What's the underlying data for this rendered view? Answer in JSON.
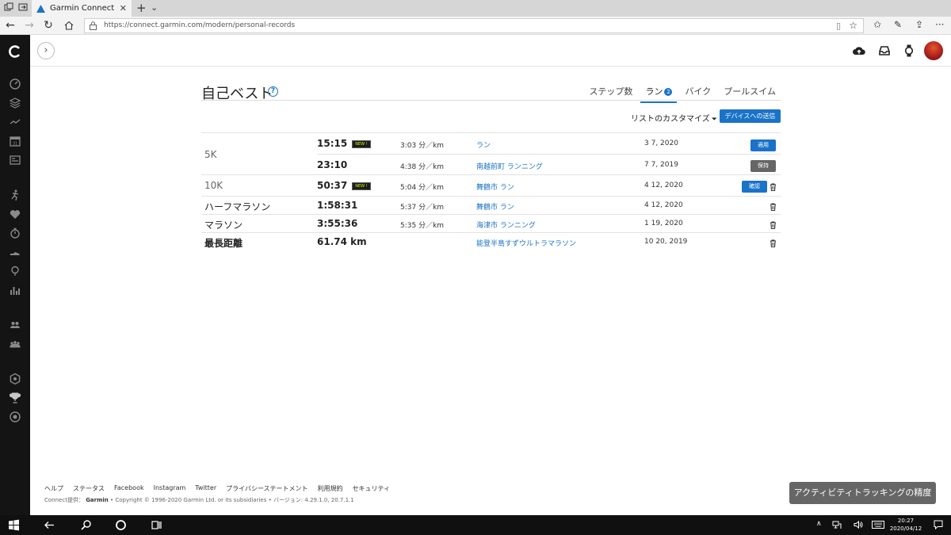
{
  "browser": {
    "tab_title": "Garmin Connect",
    "url": "https://connect.garmin.com/modern/personal-records"
  },
  "page": {
    "title": "自己ベスト",
    "help_glyph": "?",
    "tabs": [
      {
        "label": "ステップ数"
      },
      {
        "label": "ラン",
        "badge": "2"
      },
      {
        "label": "バイク"
      },
      {
        "label": "プールスイム"
      }
    ],
    "customize_label": "リストのカスタマイズ",
    "send_button": "デバイスへの送信"
  },
  "records": [
    {
      "category": "5K",
      "time": "15:15",
      "new_badge": "NEW !",
      "pace": "3:03 分／km",
      "activity": "ラン",
      "date": "3 7, 2020",
      "action": "適用"
    },
    {
      "category": "",
      "time": "23:10",
      "new_badge": "",
      "pace": "4:38 分／km",
      "activity": "南越前町 ランニング",
      "date": "7 7, 2019",
      "action": "保持"
    },
    {
      "category": "10K",
      "time": "50:37",
      "new_badge": "NEW !",
      "pace": "5:04 分／km",
      "activity": "舞鶴市 ラン",
      "date": "4 12, 2020",
      "action": "確認"
    },
    {
      "category": "ハーフマラソン",
      "time": "1:58:31",
      "new_badge": "",
      "pace": "5:37 分／km",
      "activity": "舞鶴市 ラン",
      "date": "4 12, 2020",
      "action": ""
    },
    {
      "category": "マラソン",
      "time": "3:55:36",
      "new_badge": "",
      "pace": "5:35 分／km",
      "activity": "海津市 ランニング",
      "date": "1 19, 2020",
      "action": ""
    },
    {
      "category": "最長距離",
      "time": "61.74 km",
      "new_badge": "",
      "pace": "",
      "activity": "能登半島すずウルトラマラソン",
      "date": "10 20, 2019",
      "action": ""
    }
  ],
  "footer": {
    "links": [
      "ヘルプ",
      "ステータス",
      "Facebook",
      "Instagram",
      "Twitter",
      "プライバシーステートメント",
      "利用規約",
      "セキュリティ"
    ],
    "copyright_prefix": "Connect提供：",
    "copyright_brand": "Garmin",
    "copyright_rest": "• Copyright © 1996-2020 Garmin Ltd. or its subsidiaries • バージョン: 4.29.1.0, 20.7.1.1"
  },
  "toast": "アクティビティトラッキングの精度",
  "taskbar": {
    "time": "20:27",
    "date": "2020/04/12"
  },
  "colors": {
    "accent": "#1a73c9",
    "sidebar": "#141414",
    "new_badge": "#c6ff00"
  }
}
